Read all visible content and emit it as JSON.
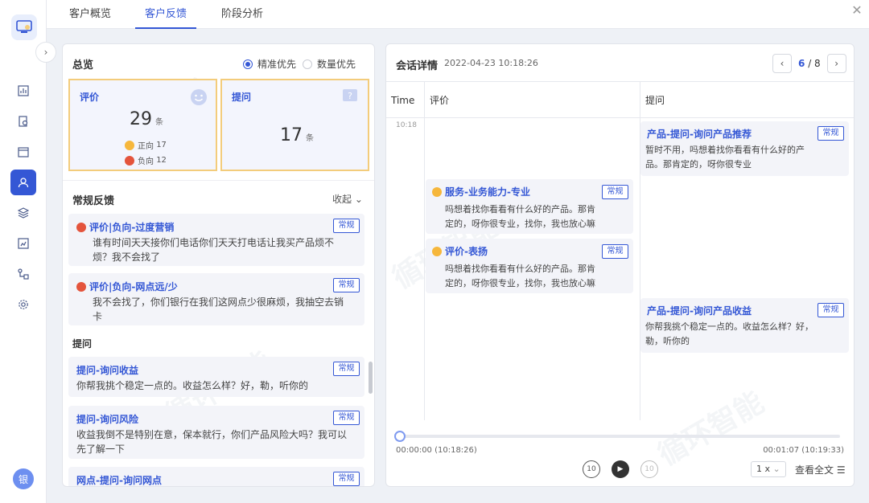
{
  "tabs": [
    {
      "label": "客户概览"
    },
    {
      "label": "客户反馈"
    },
    {
      "label": "阶段分析"
    }
  ],
  "user": {
    "avatar_text": "银"
  },
  "watermark": "循环智能",
  "overview": {
    "title": "总览",
    "radio_precise": "精准优先",
    "radio_count": "数量优先",
    "eval": {
      "label": "评价",
      "count": "29",
      "unit": "条",
      "pos_label": "正向",
      "pos_count": "17",
      "neg_label": "负向",
      "neg_count": "12"
    },
    "question": {
      "label": "提问",
      "count": "17",
      "unit": "条"
    }
  },
  "feedback": {
    "title": "常规反馈",
    "collapse_label": "收起",
    "tag": "常规",
    "eval_cards": [
      {
        "title": "评价|负向-过度营销",
        "lines": [
          "谁有时间天天接你们电话你们天天打电话让我买产品烦不",
          "烦？我不会找了"
        ]
      },
      {
        "title": "评价|负向-网点远/少",
        "lines": [
          "我不会找了，你们银行在我们这网点少很麻烦，我抽空去销",
          "卡"
        ]
      }
    ],
    "question_heading": "提问",
    "question_cards": [
      {
        "title": "提问-询问收益",
        "lines": [
          "你帮我挑个稳定一点的。收益怎么样？好，勒，听你的"
        ]
      },
      {
        "title": "提问-询问风险",
        "lines": [
          "收益我倒不是特别在意，保本就行，你们产品风险大吗？我可以",
          "先了解一下"
        ]
      },
      {
        "title": "网点-提问-询问网点",
        "lines": []
      }
    ]
  },
  "session": {
    "title": "会话详情",
    "datetime": "2022-04-23 10:18:26",
    "page_current": "6",
    "page_total": "/ 8",
    "col_time": "Time",
    "col_eval": "评价",
    "col_question": "提问",
    "time_mark": "10:18",
    "tag": "常规",
    "eval_cards": [
      {
        "title": "服务-业务能力-专业",
        "lines": [
          "吗想着找你看看有什么好的产品。那肯",
          "定的，呀你很专业，找你，我也放心嘛"
        ]
      },
      {
        "title": "评价-表扬",
        "lines": [
          "吗想着找你看看有什么好的产品。那肯",
          "定的，呀你很专业，找你，我也放心嘛"
        ]
      }
    ],
    "question_cards": [
      {
        "title": "产品-提问-询问产品推荐",
        "lines": [
          "暂时不用，吗想着找你看看有什么好的产",
          "品。那肯定的，呀你很专业"
        ]
      },
      {
        "title": "产品-提问-询问产品收益",
        "lines": [
          "你帮我挑个稳定一点的。收益怎么样？好，",
          "勒，听你的"
        ]
      }
    ],
    "player": {
      "time_start": "00:00:00 (10:18:26)",
      "time_end": "00:01:07 (10:19:33)",
      "speed": "1 x",
      "fulltext": "查看全文"
    }
  }
}
